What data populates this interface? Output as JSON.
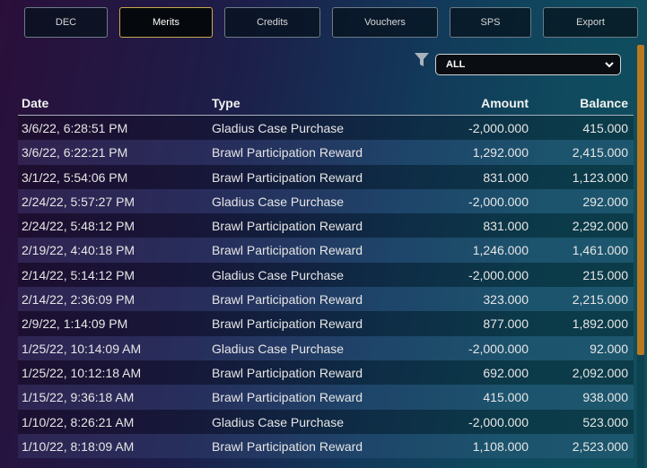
{
  "tabs": [
    {
      "label": "DEC",
      "active": false
    },
    {
      "label": "Merits",
      "active": true
    },
    {
      "label": "Credits",
      "active": false
    },
    {
      "label": "Vouchers",
      "active": false
    },
    {
      "label": "SPS",
      "active": false
    },
    {
      "label": "Export",
      "active": false
    }
  ],
  "filter": {
    "selected": "ALL",
    "icon": "filter-icon"
  },
  "table": {
    "headers": {
      "date": "Date",
      "type": "Type",
      "amount": "Amount",
      "balance": "Balance"
    },
    "rows": [
      {
        "date": "3/6/22, 6:28:51 PM",
        "type": "Gladius Case Purchase",
        "amount": "-2,000.000",
        "balance": "415.000"
      },
      {
        "date": "3/6/22, 6:22:21 PM",
        "type": "Brawl Participation Reward",
        "amount": "1,292.000",
        "balance": "2,415.000"
      },
      {
        "date": "3/1/22, 5:54:06 PM",
        "type": "Brawl Participation Reward",
        "amount": "831.000",
        "balance": "1,123.000"
      },
      {
        "date": "2/24/22, 5:57:27 PM",
        "type": "Gladius Case Purchase",
        "amount": "-2,000.000",
        "balance": "292.000"
      },
      {
        "date": "2/24/22, 5:48:12 PM",
        "type": "Brawl Participation Reward",
        "amount": "831.000",
        "balance": "2,292.000"
      },
      {
        "date": "2/19/22, 4:40:18 PM",
        "type": "Brawl Participation Reward",
        "amount": "1,246.000",
        "balance": "1,461.000"
      },
      {
        "date": "2/14/22, 5:14:12 PM",
        "type": "Gladius Case Purchase",
        "amount": "-2,000.000",
        "balance": "215.000"
      },
      {
        "date": "2/14/22, 2:36:09 PM",
        "type": "Brawl Participation Reward",
        "amount": "323.000",
        "balance": "2,215.000"
      },
      {
        "date": "2/9/22, 1:14:09 PM",
        "type": "Brawl Participation Reward",
        "amount": "877.000",
        "balance": "1,892.000"
      },
      {
        "date": "1/25/22, 10:14:09 AM",
        "type": "Gladius Case Purchase",
        "amount": "-2,000.000",
        "balance": "92.000"
      },
      {
        "date": "1/25/22, 10:12:18 AM",
        "type": "Brawl Participation Reward",
        "amount": "692.000",
        "balance": "2,092.000"
      },
      {
        "date": "1/15/22, 9:36:18 AM",
        "type": "Brawl Participation Reward",
        "amount": "415.000",
        "balance": "938.000"
      },
      {
        "date": "1/10/22, 8:26:21 AM",
        "type": "Gladius Case Purchase",
        "amount": "-2,000.000",
        "balance": "523.000"
      },
      {
        "date": "1/10/22, 8:18:09 AM",
        "type": "Brawl Participation Reward",
        "amount": "1,108.000",
        "balance": "2,523.000"
      }
    ]
  },
  "colors": {
    "accent": "#c9a94a",
    "scroll_thumb": "#b9791e"
  }
}
